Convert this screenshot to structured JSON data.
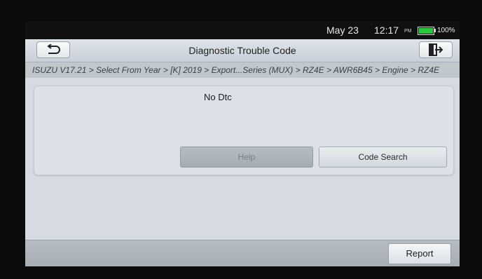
{
  "status": {
    "date": "May 23",
    "time": "12:17",
    "ampm": "PM",
    "battery_text": "100%",
    "battery_level": 1.0
  },
  "header": {
    "title": "Diagnostic Trouble Code",
    "back_icon": "back-arrow-icon",
    "exit_icon": "exit-icon"
  },
  "breadcrumb": "ISUZU V17.21 > Select From Year > [K] 2019 > Export...Series (MUX) > RZ4E > AWR6B45 > Engine > RZ4E",
  "result": {
    "message": "No Dtc"
  },
  "buttons": {
    "help": "Help",
    "code_search": "Code Search",
    "report": "Report"
  },
  "colors": {
    "battery_green": "#27c93a",
    "title_bar": "#d3d8df",
    "bottom_bar": "#b0b5bb"
  }
}
